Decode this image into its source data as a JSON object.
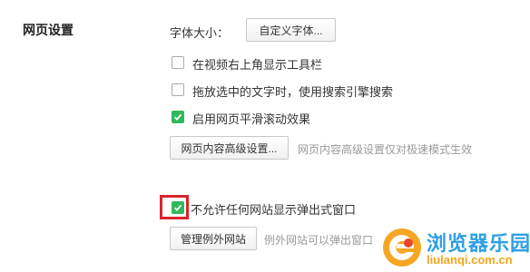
{
  "section": {
    "title": "网页设置"
  },
  "font_size": {
    "label": "字体大小：",
    "button_label": "自定义字体..."
  },
  "options": [
    {
      "label": "在视频右上角显示工具栏",
      "checked": false
    },
    {
      "label": "拖放选中的文字时，使用搜索引擎搜索",
      "checked": false
    },
    {
      "label": "启用网页平滑滚动效果",
      "checked": true
    }
  ],
  "advanced": {
    "button_label": "网页内容高级设置...",
    "hint": "网页内容高级设置仅对极速模式生效"
  },
  "popup": {
    "label": "不允许任何网站显示弹出式窗口",
    "checked": true
  },
  "exceptions": {
    "button_label": "管理例外网站",
    "hint": "例外网站可以弹出窗口"
  },
  "watermark": {
    "name_cn": "浏览器乐园",
    "name_en": "liulanqi.com.cn"
  },
  "colors": {
    "accent_green": "#2fb95c",
    "highlight_red": "#d8242a",
    "watermark_blue": "#2d9fe3",
    "watermark_orange": "#f3a51d"
  }
}
